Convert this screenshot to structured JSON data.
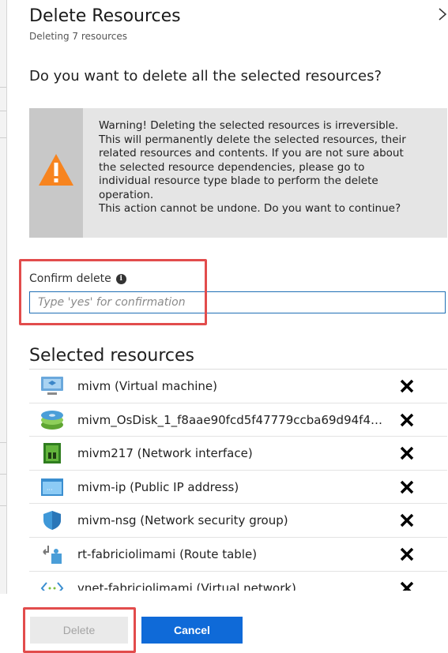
{
  "panel": {
    "title": "Delete Resources",
    "subtitle": "Deleting 7 resources"
  },
  "question": "Do you want to delete all the selected resources?",
  "warning": {
    "lines": [
      "Warning! Deleting the selected resources is irreversible.",
      "This will permanently delete the selected resources, their",
      "related resources and contents. If you are not sure about",
      "the selected resource dependencies, please go to",
      "individual resource type blade to perform the delete",
      "operation.",
      "This action cannot be undone. Do you want to continue?"
    ],
    "icon": "warning-triangle-icon",
    "accent": "#f7841f"
  },
  "confirm": {
    "label": "Confirm delete",
    "placeholder": "Type 'yes' for confirmation",
    "value": ""
  },
  "selected_resources": {
    "heading": "Selected resources",
    "items": [
      {
        "name": "mivm  (Virtual machine)",
        "icon": "virtual-machine-icon"
      },
      {
        "name": "mivm_OsDisk_1_f8aae90fcd5f47779ccba69d94f4…",
        "icon": "disk-icon"
      },
      {
        "name": "mivm217  (Network interface)",
        "icon": "network-interface-icon"
      },
      {
        "name": "mivm-ip  (Public IP address)",
        "icon": "public-ip-icon"
      },
      {
        "name": "mivm-nsg  (Network security group)",
        "icon": "network-security-group-icon"
      },
      {
        "name": "rt-fabriciolimami  (Route table)",
        "icon": "route-table-icon"
      },
      {
        "name": "vnet-fabriciolimami  (Virtual network)",
        "icon": "virtual-network-icon"
      }
    ]
  },
  "buttons": {
    "delete": "Delete",
    "cancel": "Cancel"
  },
  "colors": {
    "primary": "#0f6ad8",
    "highlight": "#e24c4c",
    "warning_bg": "#e5e5e5"
  }
}
